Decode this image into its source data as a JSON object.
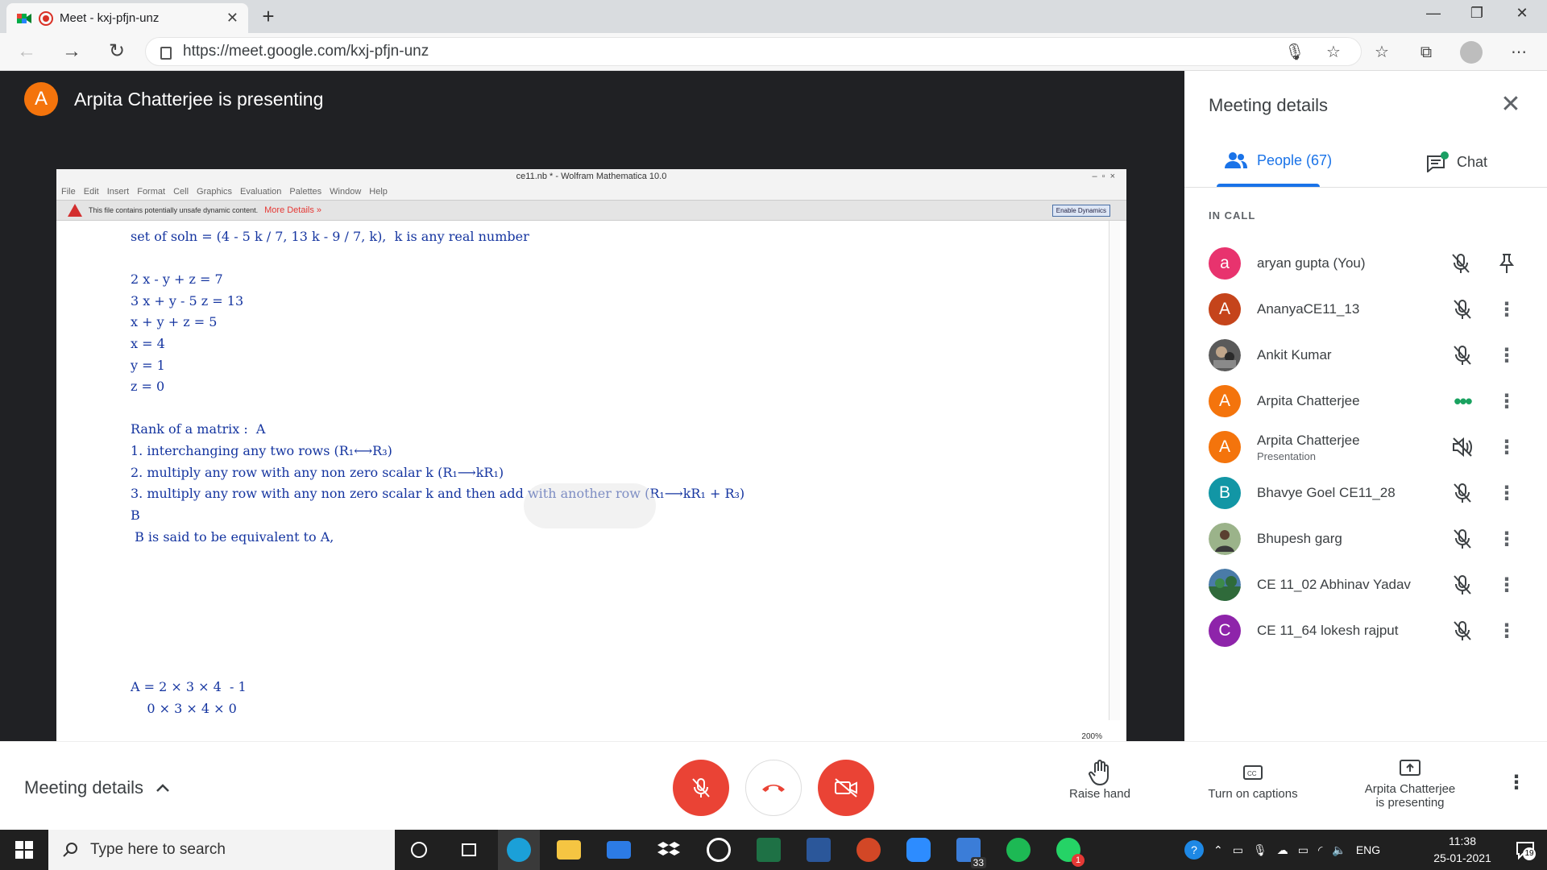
{
  "browser": {
    "tab_title": "Meet - kxj-pfjn-unz",
    "url": "https://meet.google.com/kxj-pfjn-unz"
  },
  "meet": {
    "presenter_initial": "A",
    "presenter_text": "Arpita Chatterjee is presenting"
  },
  "shared_screen": {
    "window_title": "ce11.nb * - Wolfram Mathematica 10.0",
    "menu": [
      "File",
      "Edit",
      "Insert",
      "Format",
      "Cell",
      "Graphics",
      "Evaluation",
      "Palettes",
      "Window",
      "Help"
    ],
    "warning_text": "This file contains potentially unsafe dynamic content.",
    "warning_link": "More Details »",
    "warning_button": "Enable Dynamics",
    "lines": [
      "set of soln = (4 - 5 k / 7, 13 k - 9 / 7, k),  k is any real number",
      "2 x - y + z = 7",
      "3 x + y - 5 z = 13",
      "x + y + z = 5",
      "x = 4",
      "y = 1",
      "z = 0",
      "Rank of a matrix :  A",
      "1. interchanging any two rows (R₁⟷R₃)",
      "2. multiply any row with any non zero scalar k (R₁⟶kR₁)",
      "3. multiply any row with any non zero scalar k and then add with another row (R₁⟶kR₁ + R₃)",
      "B",
      " B is said to be equivalent to A,",
      "A = 2 × 3 × 4  - 1",
      "    0 × 3 × 4 × 0"
    ],
    "zoom": "200%"
  },
  "panel": {
    "title": "Meeting details",
    "tab_people": "People (67)",
    "tab_chat": "Chat",
    "section": "IN CALL",
    "people": [
      {
        "initial": "a",
        "name": "aryan gupta (You)",
        "sub": "",
        "color": "#e8336e",
        "action": "pin"
      },
      {
        "initial": "A",
        "name": "AnanyaCE11_13",
        "sub": "",
        "color": "#c5441b",
        "action": "more"
      },
      {
        "initial": "",
        "name": "Ankit Kumar",
        "sub": "",
        "color": "#555555",
        "action": "more"
      },
      {
        "initial": "A",
        "name": "Arpita Chatterjee",
        "sub": "",
        "color": "#f4740c",
        "action": "more"
      },
      {
        "initial": "A",
        "name": "Arpita Chatterjee",
        "sub": "Presentation",
        "color": "#f4740c",
        "action": "more"
      },
      {
        "initial": "B",
        "name": "Bhavye Goel CE11_28",
        "sub": "",
        "color": "#1296a5",
        "action": "more"
      },
      {
        "initial": "",
        "name": "Bhupesh garg",
        "sub": "",
        "color": "#6b8a5a",
        "action": "more"
      },
      {
        "initial": "",
        "name": "CE 11_02 Abhinav Yadav",
        "sub": "",
        "color": "#4a7ba8",
        "action": "more"
      },
      {
        "initial": "C",
        "name": "CE 11_64 lokesh rajput",
        "sub": "",
        "color": "#8e24aa",
        "action": "more"
      }
    ]
  },
  "bottom": {
    "meeting_details": "Meeting details",
    "raise_hand": "Raise hand",
    "captions": "Turn on captions",
    "presenting_line1": "Arpita Chatterjee",
    "presenting_line2": "is presenting"
  },
  "taskbar": {
    "search_placeholder": "Type here to search",
    "badge_count": "33",
    "whatsapp_badge": "1",
    "lang": "ENG",
    "time": "11:38",
    "date": "25-01-2021",
    "notif_count": "19"
  },
  "colors": {
    "accent": "#1a73e8",
    "red": "#ea4335",
    "presenter": "#f4740c"
  }
}
